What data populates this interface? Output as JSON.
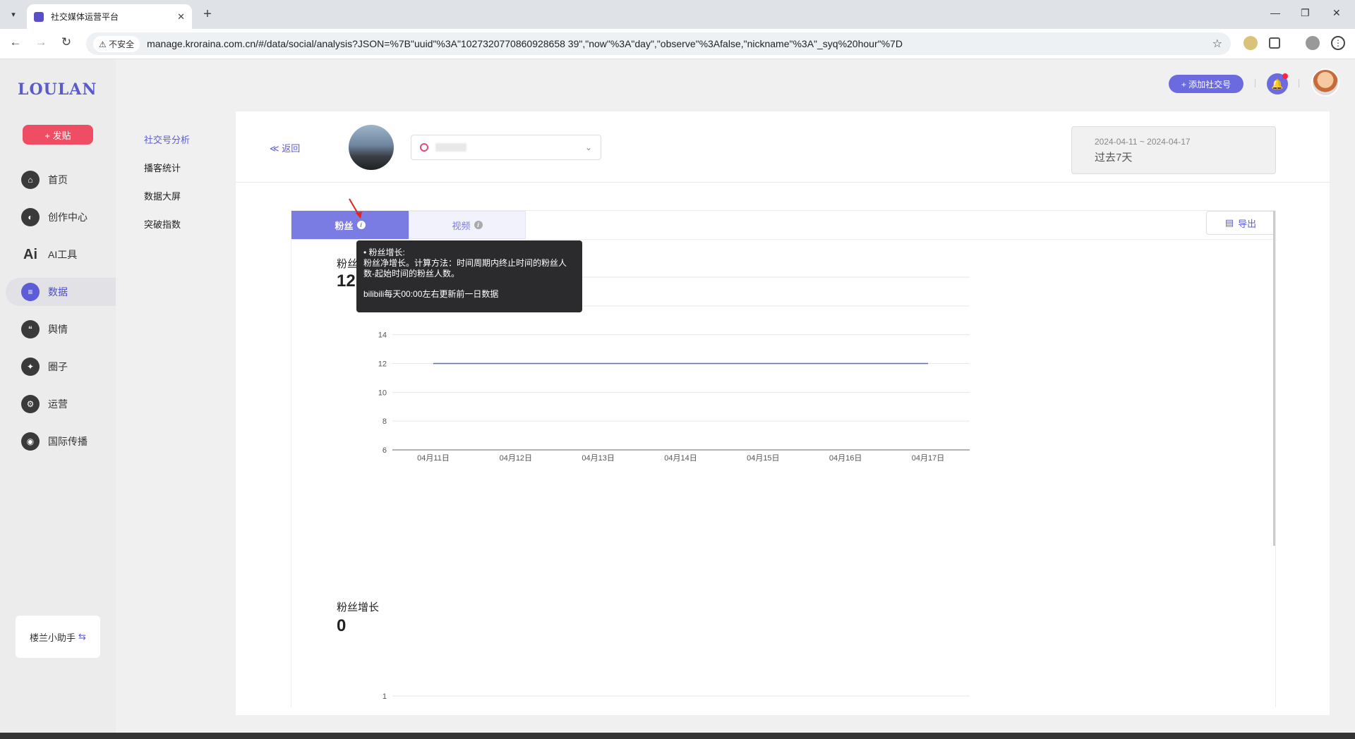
{
  "browser": {
    "tab_title": "社交媒体运营平台",
    "security_label": "不安全",
    "url": "manage.kroraina.com.cn/#/data/social/analysis?JSON=%7B\"uuid\"%3A\"1027320770860928658 39\",\"now\"%3A\"day\",\"observe\"%3Afalse,\"nickname\"%3A\"_syq%20hour\"%7D"
  },
  "app": {
    "logo": "LOULAN",
    "post_button": "+ 发贴",
    "nav": [
      {
        "label": "首页",
        "icon": "home-icon"
      },
      {
        "label": "创作中心",
        "icon": "palette-icon"
      },
      {
        "label": "AI工具",
        "icon": "ai-icon"
      },
      {
        "label": "数据",
        "icon": "database-icon"
      },
      {
        "label": "舆情",
        "icon": "quote-icon"
      },
      {
        "label": "圈子",
        "icon": "compass-icon"
      },
      {
        "label": "运营",
        "icon": "operations-icon"
      },
      {
        "label": "国际传播",
        "icon": "globe-icon"
      }
    ],
    "helper": "楼兰小助手",
    "subnav": [
      "社交号分析",
      "播客统计",
      "数据大屏",
      "突破指数"
    ],
    "add_social": "+ 添加社交号"
  },
  "header": {
    "back": "≪ 返回",
    "date_range": "2024-04-11 ~ 2024-04-17",
    "date_label": "过去7天"
  },
  "tabs": {
    "fans": "粉丝",
    "video": "视频",
    "export": "导出"
  },
  "metrics": {
    "fans_label": "粉丝",
    "fans_value": "12",
    "growth_label": "粉丝增长",
    "growth_value": "0"
  },
  "tooltip": {
    "line1": "• 粉丝增长:",
    "line2": "粉丝净增长。计算方法：时间周期内终止时间的粉丝人",
    "line3": "数-起始时间的粉丝人数。",
    "line4": "bilibili每天00:00左右更新前一日数据"
  },
  "colors": {
    "accent": "#5c5cd6",
    "line": "#4a6fd0"
  },
  "chart_data": [
    {
      "type": "line",
      "x": [
        "04月11日",
        "04月12日",
        "04月13日",
        "04月14日",
        "04月15日",
        "04月16日",
        "04月17日"
      ],
      "values": [
        12,
        12,
        12,
        12,
        12,
        12,
        12
      ],
      "yticks": [
        6,
        8,
        10,
        12,
        14,
        16,
        18
      ],
      "ylim": [
        6,
        18
      ],
      "grid": true
    },
    {
      "type": "line",
      "yticks": [
        1
      ],
      "grid": true
    }
  ]
}
